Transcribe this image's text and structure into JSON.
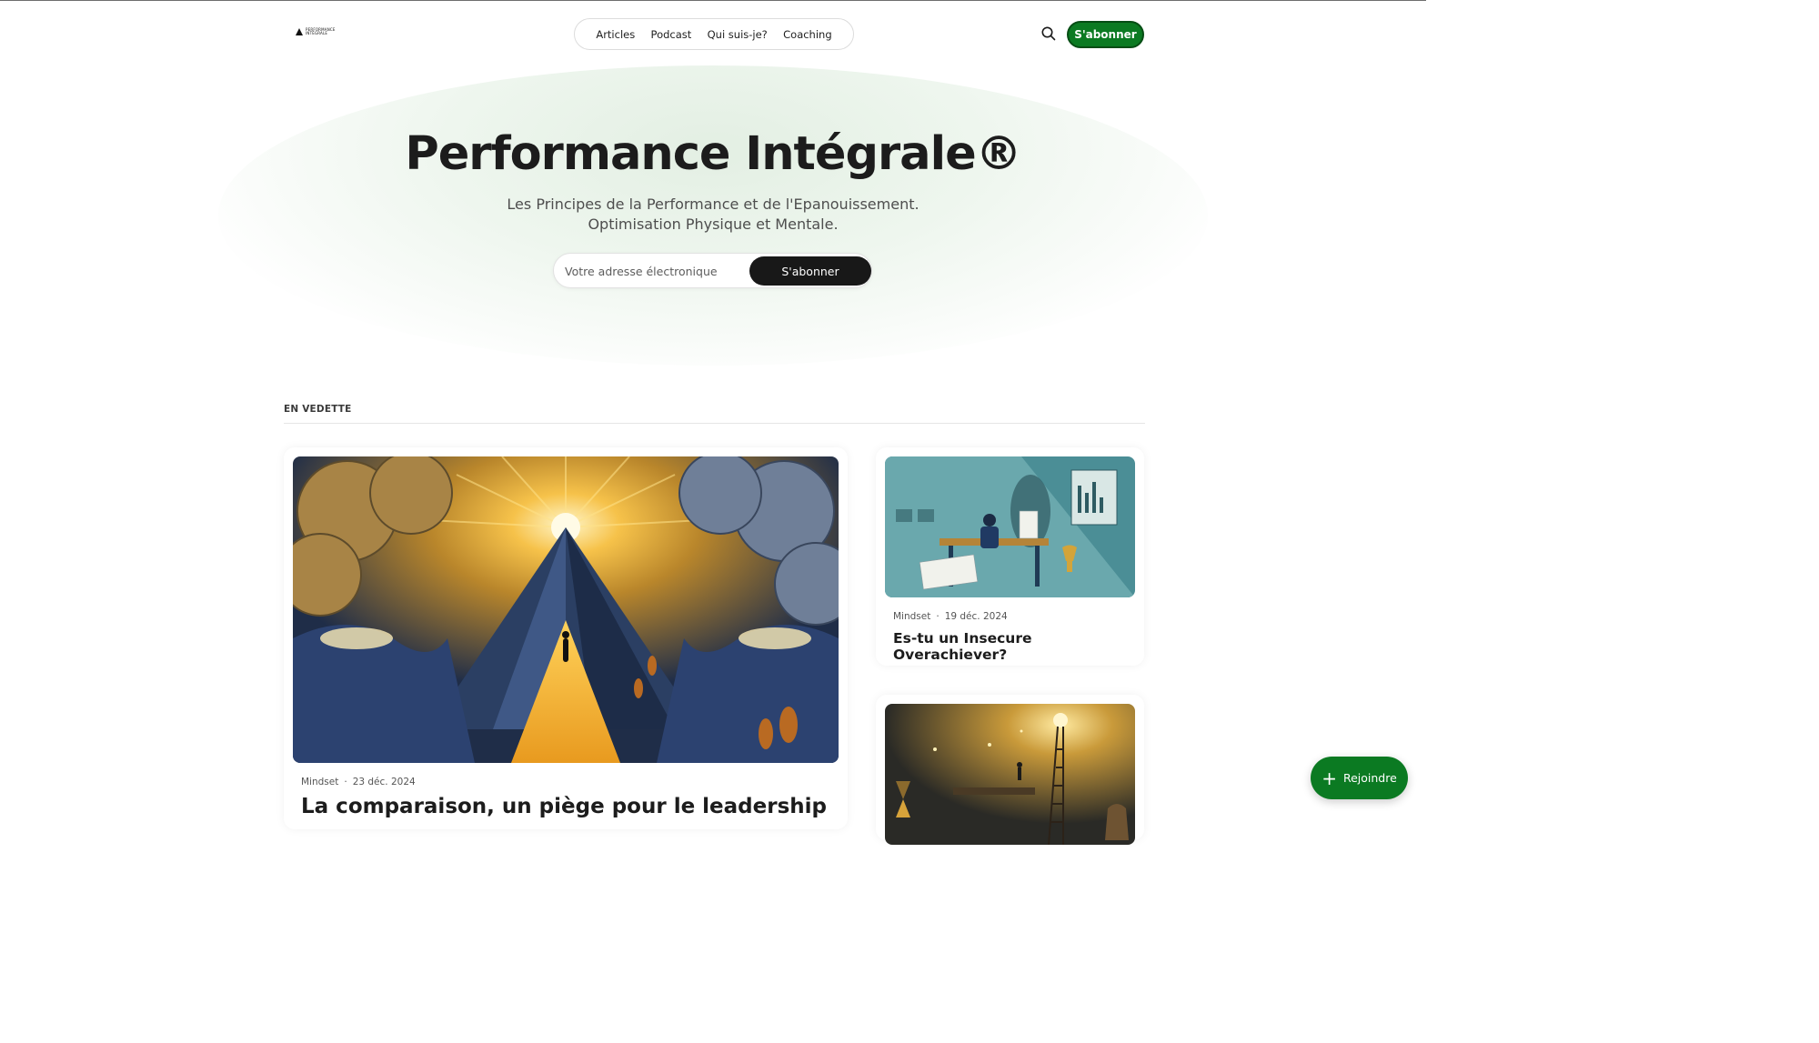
{
  "site": {
    "logo_text": "PERFORMANCE INTÉGRALE"
  },
  "nav": {
    "items": [
      {
        "label": "Articles"
      },
      {
        "label": "Podcast"
      },
      {
        "label": "Qui suis-je?"
      },
      {
        "label": "Coaching"
      }
    ]
  },
  "header": {
    "search_icon": "search-icon",
    "subscribe_label": "S'abonner"
  },
  "hero": {
    "title": "Performance Intégrale®",
    "subtitle": "Les Principes de la Performance et de l'Epanouissement. Optimisation Physique et Mentale.",
    "email_placeholder": "Votre adresse électronique",
    "subscribe_label": "S'abonner"
  },
  "featured": {
    "section_label": "EN VEDETTE",
    "main": {
      "tag": "Mindset",
      "date": "23 déc. 2024",
      "title": "La comparaison, un piège pour le leadership"
    },
    "side": [
      {
        "tag": "Mindset",
        "date": "19 déc. 2024",
        "title": "Es-tu un Insecure Overachiever?"
      }
    ]
  },
  "floating": {
    "join_label": "Rejoindre"
  },
  "colors": {
    "brand_green": "#0b7a22",
    "dark_button": "#181818"
  }
}
